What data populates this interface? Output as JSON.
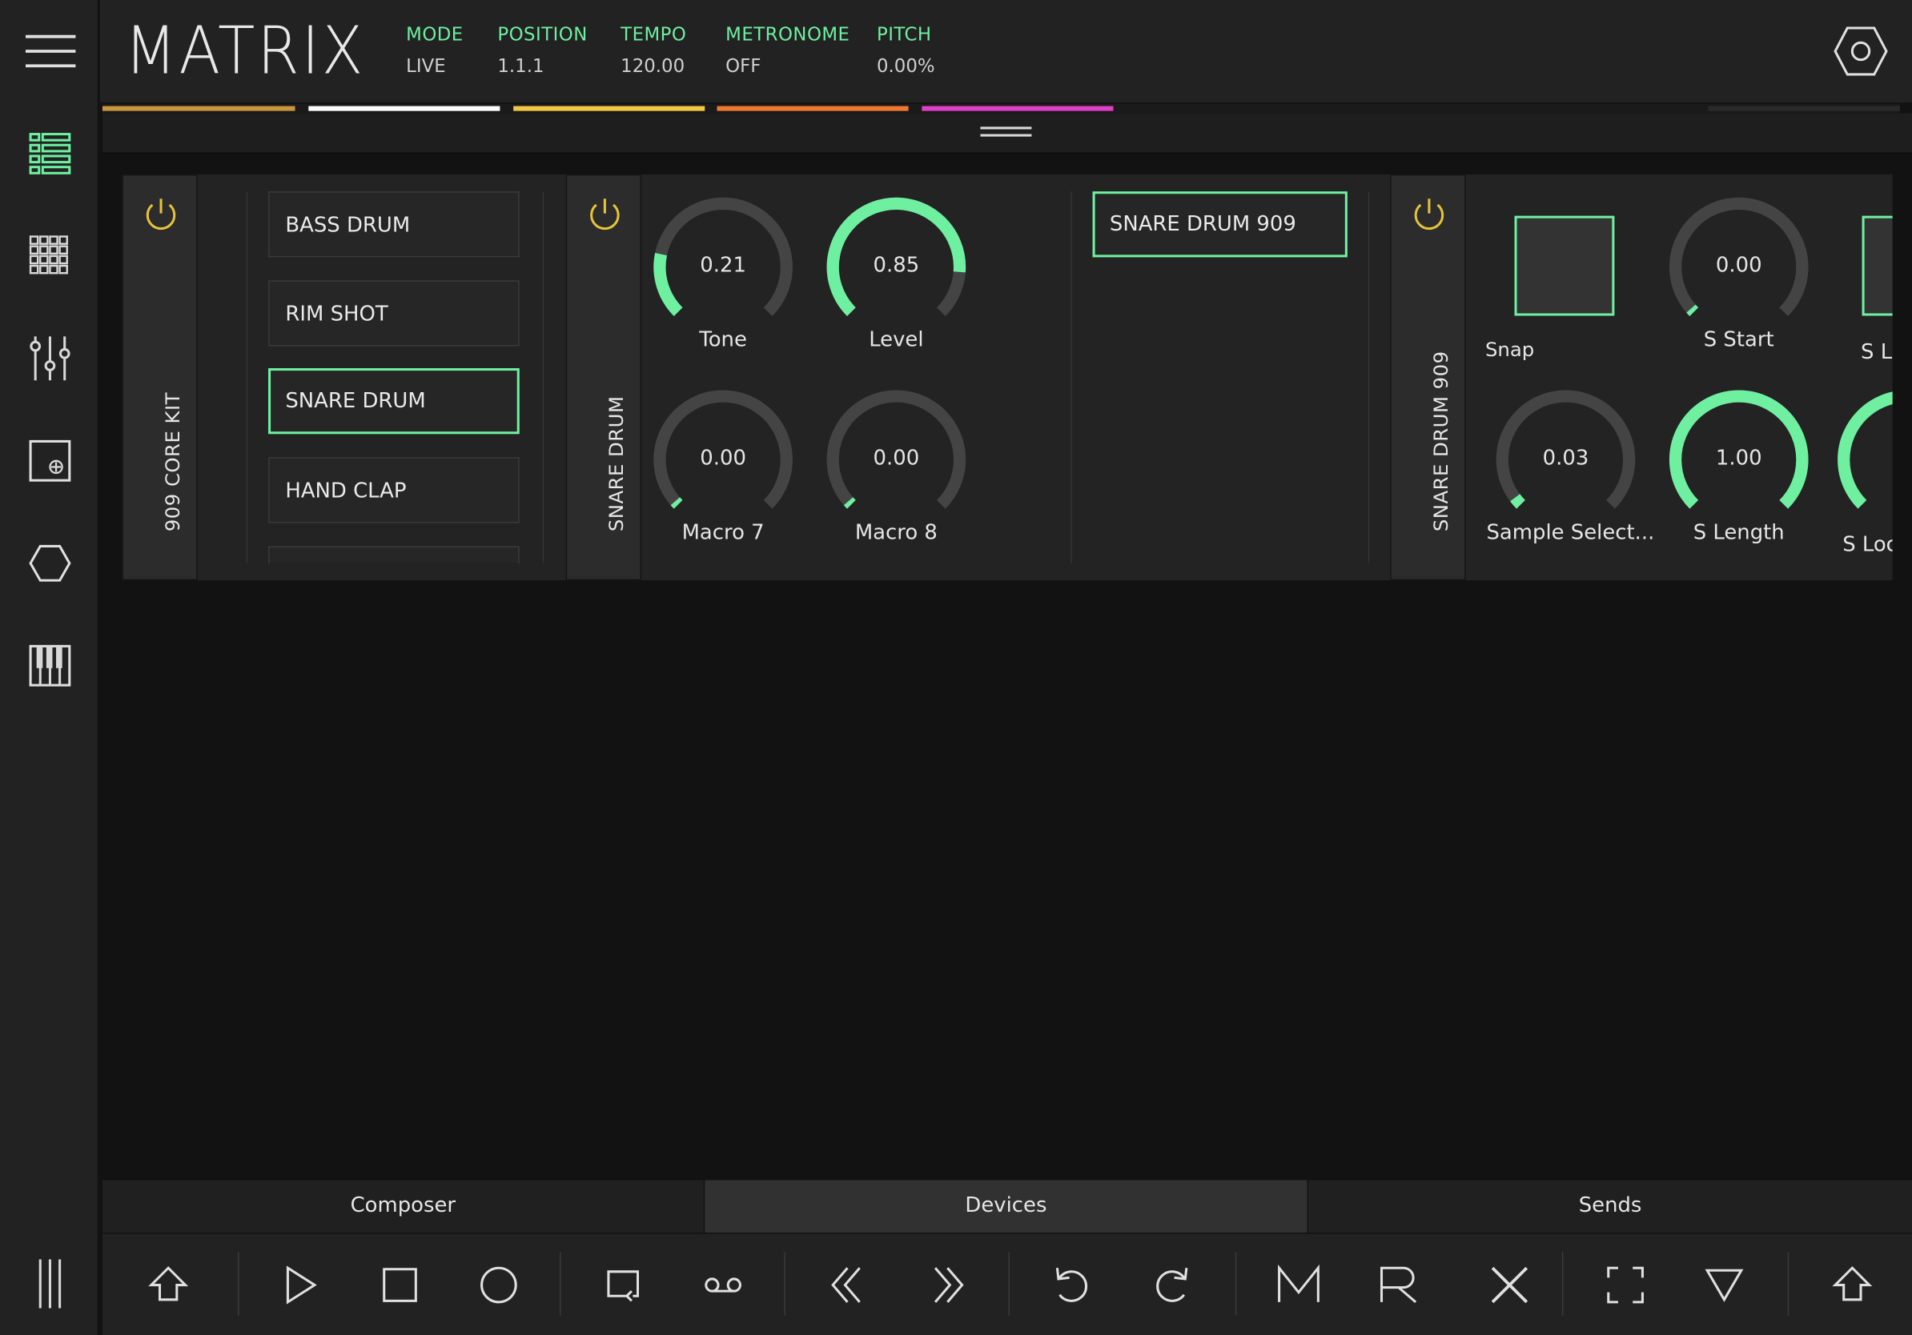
{
  "app": {
    "title": "MATRIX",
    "accent_color": "#6ef0a0",
    "power_color": "#e6c23a"
  },
  "header": {
    "stats": [
      {
        "label": "MODE",
        "value": "LIVE"
      },
      {
        "label": "POSITION",
        "value": "1.1.1"
      },
      {
        "label": "TEMPO",
        "value": "120.00"
      },
      {
        "label": "METRONOME",
        "value": "OFF"
      },
      {
        "label": "PITCH",
        "value": "0.00%"
      }
    ],
    "clip_colors": [
      "#c8963c",
      "#ffffff",
      "#f2c744",
      "#f07830",
      "#e040c8"
    ]
  },
  "sidebar": {
    "items": [
      {
        "icon": "track-list-icon",
        "active": true
      },
      {
        "icon": "clip-grid-icon",
        "active": false
      },
      {
        "icon": "mixer-icon",
        "active": false
      },
      {
        "icon": "add-device-icon",
        "active": false
      },
      {
        "icon": "hexagon-icon",
        "active": false
      },
      {
        "icon": "piano-keys-icon",
        "active": false
      }
    ]
  },
  "devices": {
    "kit": {
      "title": "909 CORE KIT",
      "slots": [
        "BASS DRUM",
        "RIM SHOT",
        "SNARE DRUM",
        "HAND CLAP"
      ],
      "selected_slot": "SNARE DRUM"
    },
    "chain": {
      "title": "SNARE DRUM",
      "knobs": [
        {
          "label": "Tone",
          "value": "0.21",
          "level": 0.21
        },
        {
          "label": "Level",
          "value": "0.85",
          "level": 0.85
        },
        {
          "label": "Macro 7",
          "value": "0.00",
          "level": 0.0
        },
        {
          "label": "Macro 8",
          "value": "0.00",
          "level": 0.0
        }
      ],
      "inner_slot": "SNARE DRUM 909"
    },
    "sampler": {
      "title": "SNARE DRUM 909",
      "snap_label": "Snap",
      "knobs": [
        {
          "label": "S Start",
          "value": "0.00",
          "level": 0.0
        },
        {
          "label": "Sample Select...",
          "value": "0.03",
          "level": 0.03
        },
        {
          "label": "S Length",
          "value": "1.00",
          "level": 1.0
        }
      ],
      "clipped_labels": [
        "S Lo",
        "S Loo"
      ]
    }
  },
  "tabs": [
    {
      "label": "Composer",
      "active": false
    },
    {
      "label": "Devices",
      "active": true
    },
    {
      "label": "Sends",
      "active": false
    }
  ],
  "transport": {
    "buttons": [
      "shift-icon",
      "play-icon",
      "stop-icon",
      "record-icon",
      "loop-icon",
      "overdub-icon",
      "rewind-icon",
      "fast-forward-icon",
      "undo-icon",
      "redo-icon",
      "mute-icon",
      "rec-arm-icon",
      "close-icon",
      "fullscreen-icon",
      "dropdown-icon",
      "shift-right-icon"
    ]
  }
}
